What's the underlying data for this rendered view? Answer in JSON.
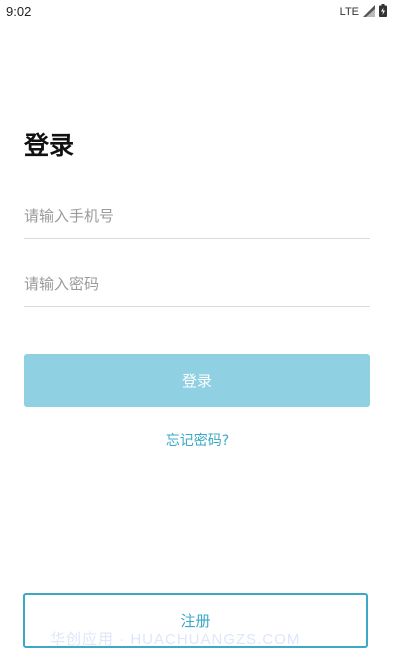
{
  "status_bar": {
    "time": "9:02",
    "network": "LTE"
  },
  "login": {
    "title": "登录",
    "phone_placeholder": "请输入手机号",
    "password_placeholder": "请输入密码",
    "login_button": "登录",
    "forgot_password": "忘记密码?",
    "register_button": "注册"
  },
  "watermark": "华创应用 · HUACHUANGZS.COM",
  "colors": {
    "accent": "#3aa8c6",
    "login_button_bg": "#8fd0e2"
  },
  "icons": {
    "signal": "signal-icon",
    "battery": "battery-icon"
  }
}
